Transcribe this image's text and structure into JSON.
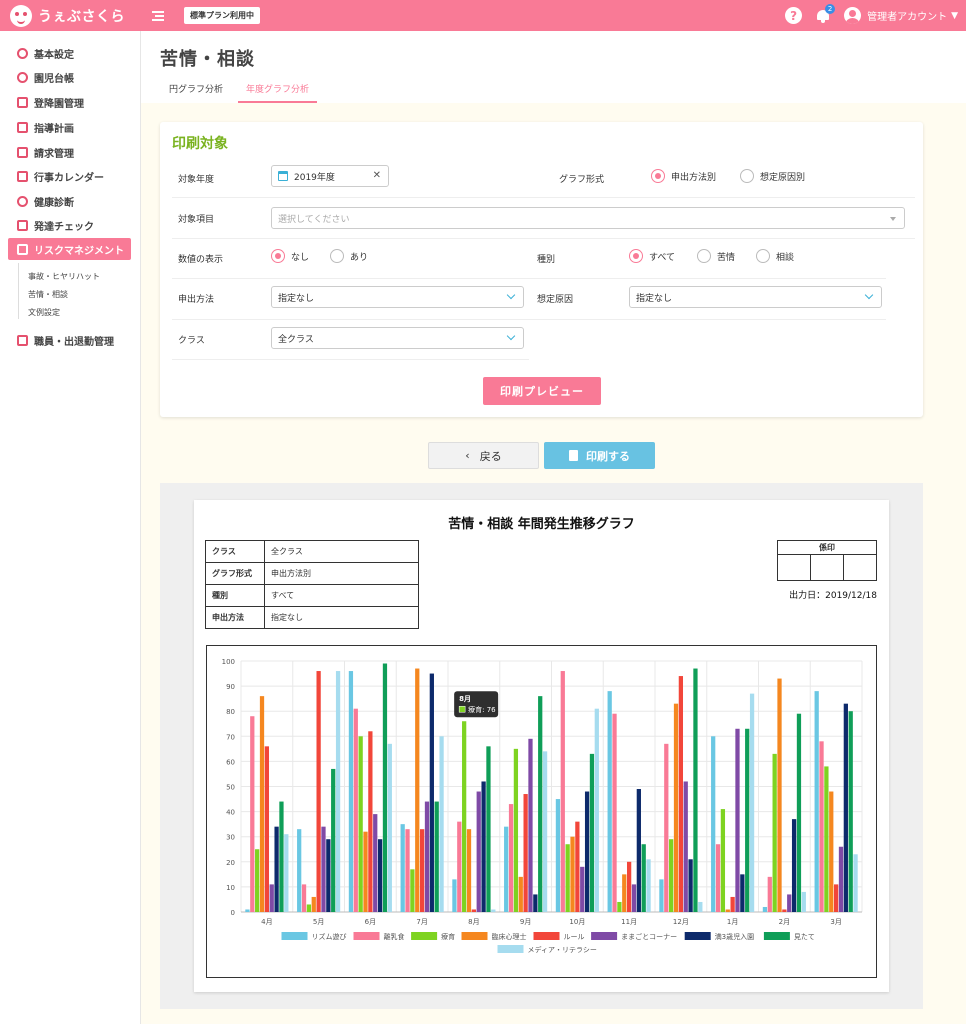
{
  "app": {
    "logo_text": "うぇぶさくら",
    "plan_badge": "標準プラン利用中",
    "notification_count": "2",
    "user_name": "管理者アカウント"
  },
  "sidebar": {
    "items": [
      {
        "label": "基本設定",
        "icon": "gear-icon"
      },
      {
        "label": "園児台帳",
        "icon": "child-icon"
      },
      {
        "label": "登降園管理",
        "icon": "attendance-icon"
      },
      {
        "label": "指導計画",
        "icon": "notebook-icon"
      },
      {
        "label": "請求管理",
        "icon": "calculator-icon"
      },
      {
        "label": "行事カレンダー",
        "icon": "calendar-icon"
      },
      {
        "label": "健康診断",
        "icon": "stethoscope-icon"
      },
      {
        "label": "発達チェック",
        "icon": "checklist-icon"
      },
      {
        "label": "リスクマネジメント",
        "icon": "handshake-icon",
        "active": true
      },
      {
        "label": "職員・出退勤管理",
        "icon": "briefcase-icon"
      }
    ],
    "subitems": [
      "事故・ヒヤリハット",
      "苦情・相談",
      "文例設定"
    ]
  },
  "page": {
    "title": "苦情・相談",
    "tabs": [
      {
        "label": "円グラフ分析",
        "active": false
      },
      {
        "label": "年度グラフ分析",
        "active": true
      }
    ]
  },
  "filter": {
    "title": "印刷対象",
    "year_label": "対象年度",
    "year_value": "2019年度",
    "graph_format_label": "グラフ形式",
    "graph_format_options": [
      "申出方法別",
      "想定原因別"
    ],
    "item_label": "対象項目",
    "item_placeholder": "選択してください",
    "value_display_label": "数値の表示",
    "value_display_options": [
      "なし",
      "あり"
    ],
    "type_label": "種別",
    "type_options": [
      "すべて",
      "苦情",
      "相談"
    ],
    "method_label": "申出方法",
    "method_value": "指定なし",
    "cause_label": "想定原因",
    "cause_value": "指定なし",
    "class_label": "クラス",
    "class_value": "全クラス",
    "preview_button": "印刷プレビュー"
  },
  "actions": {
    "back": "戻る",
    "print": "印刷する"
  },
  "report": {
    "title": "苦情・相談 年間発生推移グラフ",
    "info": [
      {
        "key": "クラス",
        "value": "全クラス"
      },
      {
        "key": "グラフ形式",
        "value": "申出方法別"
      },
      {
        "key": "種別",
        "value": "すべて"
      },
      {
        "key": "申出方法",
        "value": "指定なし"
      }
    ],
    "seal_label": "係印",
    "output_date": "出力日：2019/12/18"
  },
  "chart_data": {
    "type": "bar",
    "categories": [
      "4月",
      "5月",
      "6月",
      "7月",
      "8月",
      "9月",
      "10月",
      "11月",
      "12月",
      "1月",
      "2月",
      "3月"
    ],
    "ylim": [
      0,
      100
    ],
    "yticks": [
      0,
      10,
      20,
      30,
      40,
      50,
      60,
      70,
      80,
      90,
      100
    ],
    "grid": true,
    "legend_position": "bottom",
    "series": [
      {
        "name": "リズム遊び",
        "color": "#6ac7e3",
        "values": [
          1,
          33,
          96,
          35,
          13,
          34,
          45,
          88,
          13,
          70,
          2,
          88
        ]
      },
      {
        "name": "離乳食",
        "color": "#f97a96",
        "values": [
          78,
          11,
          81,
          33,
          36,
          43,
          96,
          79,
          67,
          27,
          14,
          68
        ]
      },
      {
        "name": "療育",
        "color": "#7ed321",
        "values": [
          25,
          3,
          70,
          17,
          76,
          65,
          27,
          4,
          29,
          41,
          63,
          58
        ]
      },
      {
        "name": "臨床心理士",
        "color": "#f5871f",
        "values": [
          86,
          6,
          32,
          97,
          33,
          14,
          30,
          15,
          83,
          1,
          93,
          48
        ]
      },
      {
        "name": "ルール",
        "color": "#f2463a",
        "values": [
          66,
          96,
          72,
          33,
          1,
          47,
          36,
          20,
          94,
          6,
          1,
          11
        ]
      },
      {
        "name": "ままごとコーナー",
        "color": "#7f4aa6",
        "values": [
          11,
          34,
          39,
          44,
          48,
          69,
          18,
          11,
          52,
          73,
          7,
          26
        ]
      },
      {
        "name": "満3歳児入園",
        "color": "#0d2a6b",
        "values": [
          34,
          29,
          29,
          95,
          52,
          7,
          48,
          49,
          21,
          15,
          37,
          83
        ]
      },
      {
        "name": "見たて",
        "color": "#0f9e58",
        "values": [
          44,
          57,
          99,
          44,
          66,
          86,
          63,
          27,
          97,
          73,
          79,
          80
        ]
      },
      {
        "name": "メディア・リテラシー",
        "color": "#a6dcef",
        "values": [
          31,
          96,
          67,
          70,
          1,
          64,
          81,
          21,
          4,
          87,
          8,
          23
        ]
      }
    ],
    "tooltip": {
      "title": "8月",
      "text": "療育: 76",
      "series_index": 2,
      "category_index": 4
    }
  },
  "colors": {
    "brand_pink": "#f97a96",
    "accent_green": "#7ab320",
    "accent_blue": "#68c2e2"
  }
}
